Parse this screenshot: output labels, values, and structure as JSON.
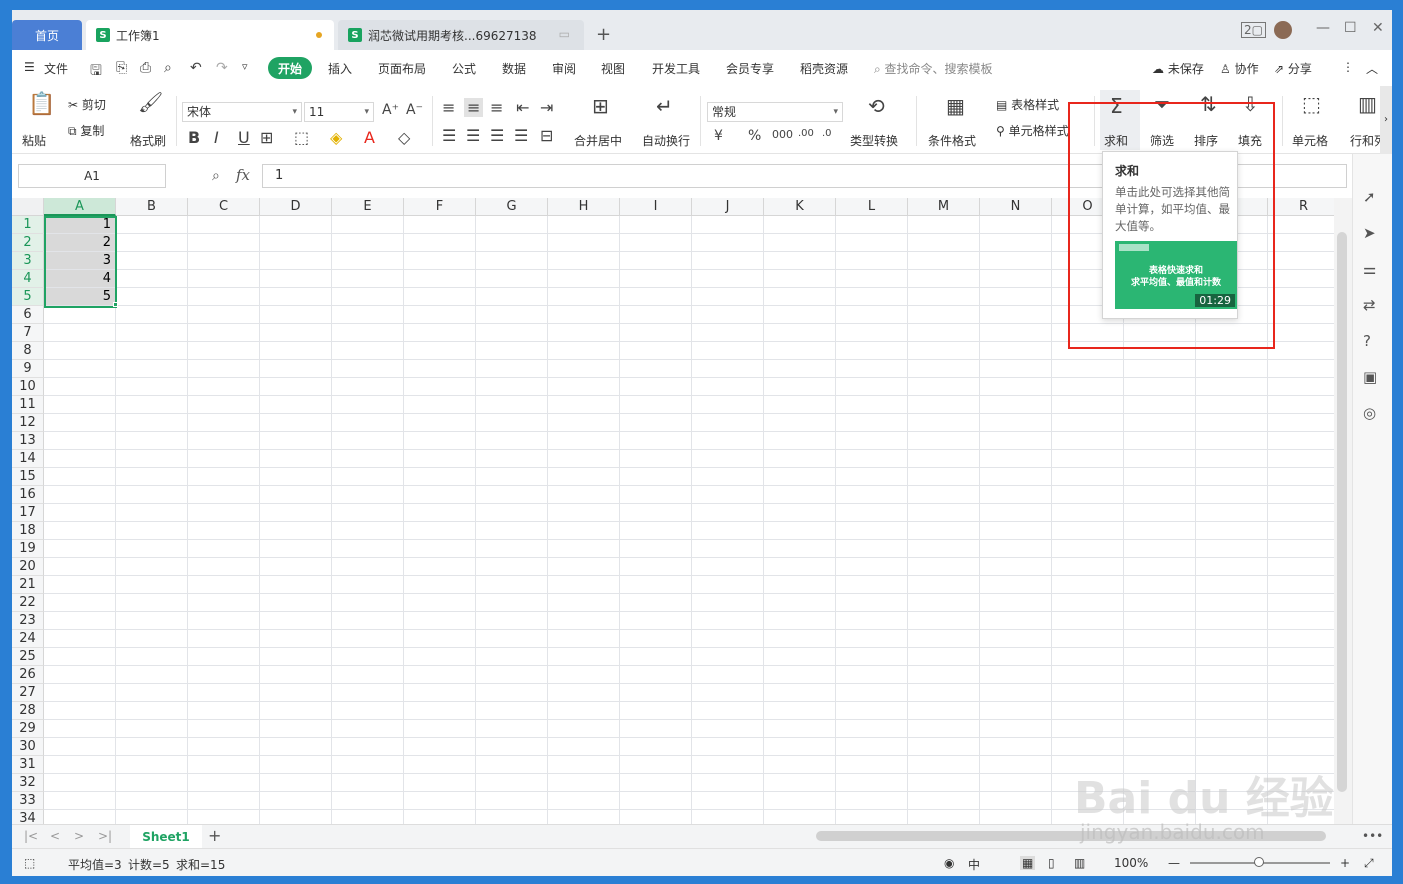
{
  "titlebar": {
    "home_tab": "首页",
    "doc_tab": "工作簿1",
    "doc2_tab": "润芯微试用期考核...69627138",
    "s_letter": "S",
    "add": "+",
    "minimize": "—",
    "maximize": "☐",
    "close": "✕"
  },
  "menubar": {
    "file": "文件",
    "start": "开始",
    "items": [
      "插入",
      "页面布局",
      "公式",
      "数据",
      "审阅",
      "视图",
      "开发工具",
      "会员专享",
      "稻壳资源"
    ],
    "search_placeholder": "查找命令、搜索模板",
    "unsaved": "未保存",
    "collab": "协作",
    "share": "分享"
  },
  "ribbon": {
    "paste": "粘贴",
    "cut": "剪切",
    "copy": "复制",
    "format_painter": "格式刷",
    "font_name": "宋体",
    "font_size": "11",
    "merge_center": "合并居中",
    "wrap_text": "自动换行",
    "number_format": "常规",
    "type_convert": "类型转换",
    "cond_format": "条件格式",
    "table_style": "表格样式",
    "cell_style": "单元格样式",
    "sum": "求和",
    "filter": "筛选",
    "sort": "排序",
    "fill": "填充",
    "cell": "单元格",
    "row_col": "行和列"
  },
  "formula_bar": {
    "name_box": "A1",
    "fx_label": "fx",
    "value": "1"
  },
  "grid": {
    "columns": [
      "A",
      "B",
      "C",
      "D",
      "E",
      "F",
      "G",
      "H",
      "I",
      "J",
      "K",
      "L",
      "M",
      "N",
      "O",
      "P",
      "Q",
      "R"
    ],
    "rows": [
      "1",
      "2",
      "3",
      "4",
      "5",
      "6",
      "7",
      "8",
      "9",
      "10",
      "11",
      "12",
      "13",
      "14",
      "15",
      "16",
      "17",
      "18",
      "19",
      "20",
      "21",
      "22",
      "23",
      "24",
      "25",
      "26",
      "27",
      "28",
      "29",
      "30",
      "31",
      "32",
      "33",
      "34"
    ],
    "cells_a": [
      "1",
      "2",
      "3",
      "4",
      "5"
    ]
  },
  "tooltip": {
    "title": "求和",
    "desc": "单击此处可选择其他简单计算，如平均值、最大值等。",
    "thumb_line1": "表格快速求和",
    "thumb_line2": "求平均值、最值和计数",
    "duration": "01:29"
  },
  "sheets": {
    "active": "Sheet1",
    "add": "+"
  },
  "status": {
    "average": "平均值=3",
    "count": "计数=5",
    "sum": "求和=15",
    "zoom": "100%"
  },
  "watermark": {
    "brand": "Bai du 经验",
    "url": "jingyan.baidu.com"
  },
  "colors": {
    "accent": "#1fa363",
    "home_tab": "#4b7fd5",
    "highlight_box": "#e8261c"
  }
}
